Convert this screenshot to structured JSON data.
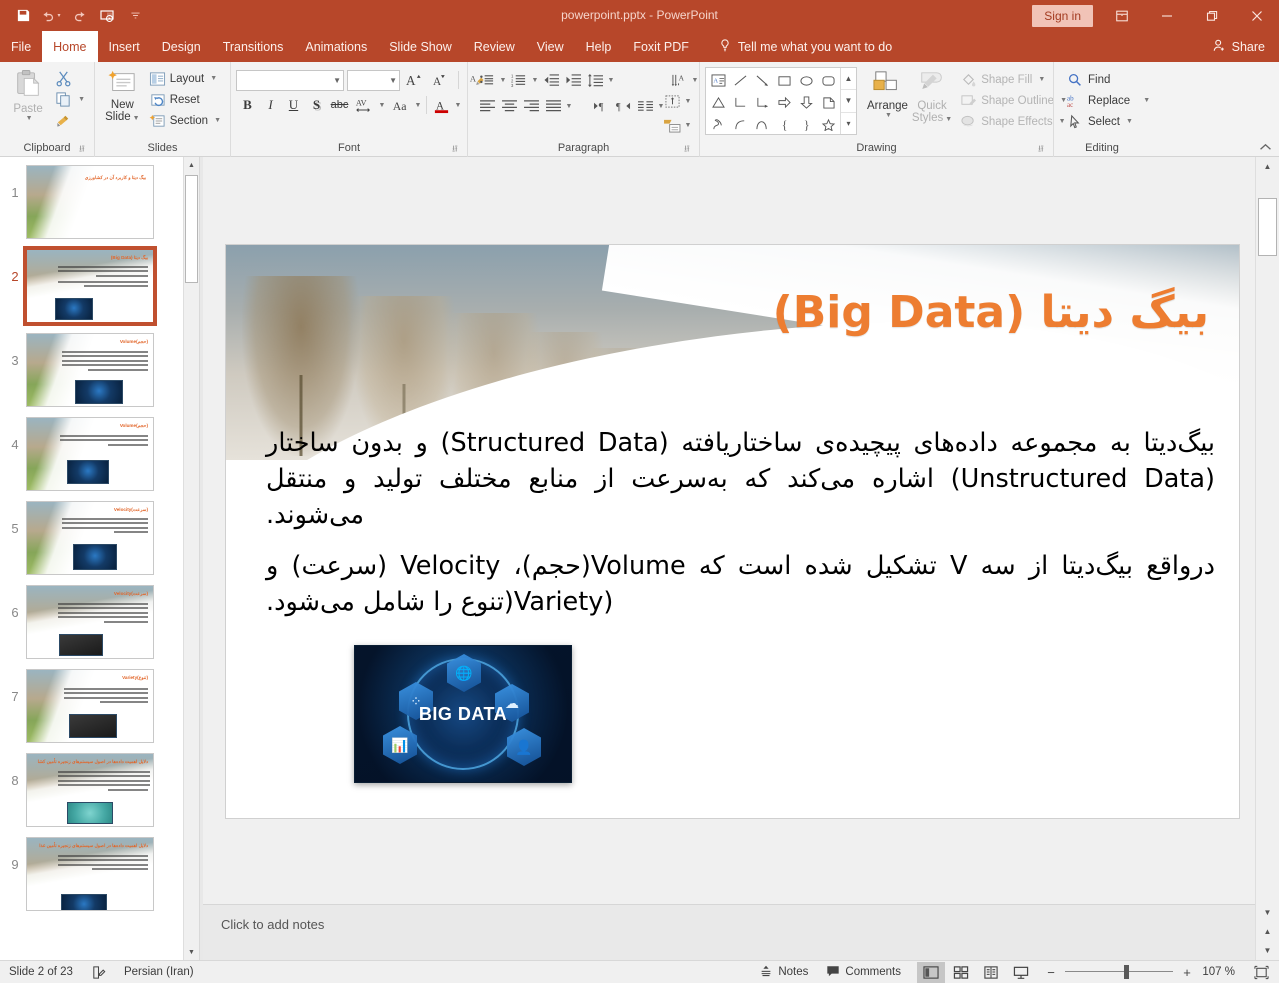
{
  "titlebar": {
    "filename": "powerpoint.pptx  -  PowerPoint",
    "signin_label": "Sign in",
    "qat": [
      {
        "name": "save-icon",
        "label": "Save"
      },
      {
        "name": "undo-icon",
        "label": "Undo"
      },
      {
        "name": "redo-icon",
        "label": "Redo"
      },
      {
        "name": "start-slideshow-icon",
        "label": "Start From Beginning"
      },
      {
        "name": "customize-qat-icon",
        "label": "Customize Quick Access Toolbar"
      }
    ],
    "window_buttons": [
      {
        "name": "ribbon-display-options",
        "glyph": "⬚"
      },
      {
        "name": "minimize-button",
        "glyph": "─"
      },
      {
        "name": "restore-button",
        "glyph": "❐"
      },
      {
        "name": "close-button",
        "glyph": "✕"
      }
    ]
  },
  "tabs": [
    {
      "label": "File",
      "active": false
    },
    {
      "label": "Home",
      "active": true
    },
    {
      "label": "Insert",
      "active": false
    },
    {
      "label": "Design",
      "active": false
    },
    {
      "label": "Transitions",
      "active": false
    },
    {
      "label": "Animations",
      "active": false
    },
    {
      "label": "Slide Show",
      "active": false
    },
    {
      "label": "Review",
      "active": false
    },
    {
      "label": "View",
      "active": false
    },
    {
      "label": "Help",
      "active": false
    },
    {
      "label": "Foxit PDF",
      "active": false
    }
  ],
  "tellme": {
    "label": "Tell me what you want to do",
    "icon": "lightbulb-icon"
  },
  "share": {
    "label": "Share",
    "icon": "share-person-icon"
  },
  "ribbon": {
    "clipboard": {
      "group_label": "Clipboard",
      "paste_label": "Paste",
      "cut_label": "Cut",
      "copy_label": "Copy",
      "format_painter_label": "Format Painter"
    },
    "slides": {
      "group_label": "Slides",
      "new_slide_line1": "New",
      "new_slide_line2": "Slide",
      "layout_label": "Layout",
      "reset_label": "Reset",
      "section_label": "Section"
    },
    "font": {
      "group_label": "Font",
      "font_name_value": "",
      "font_name_placeholder": "",
      "font_size_value": "",
      "buttons": [
        "B",
        "I",
        "U",
        "S",
        "abc",
        "AV",
        "Aa",
        "A"
      ]
    },
    "paragraph": {
      "group_label": "Paragraph"
    },
    "drawing": {
      "group_label": "Drawing",
      "arrange_label": "Arrange",
      "quick_styles_line1": "Quick",
      "quick_styles_line2": "Styles",
      "shape_fill_label": "Shape Fill",
      "shape_outline_label": "Shape Outline",
      "shape_effects_label": "Shape Effects"
    },
    "editing": {
      "group_label": "Editing",
      "find_label": "Find",
      "replace_label": "Replace",
      "select_label": "Select"
    }
  },
  "thumbnails": [
    {
      "num": "1",
      "title": "بیگ دیتا و کاربرد آن در کشاورزی",
      "lines": 0,
      "selected": false,
      "image": "none",
      "layout": "cover"
    },
    {
      "num": "2",
      "title": "بیگ دیتا (Big Data)",
      "lines": 6,
      "selected": true,
      "image": "blue",
      "layout": "content"
    },
    {
      "num": "3",
      "title": "(حجم)Volume",
      "lines": 6,
      "selected": false,
      "image": "blue",
      "layout": "content"
    },
    {
      "num": "4",
      "title": "(حجم)Volume",
      "lines": 3,
      "selected": false,
      "image": "blue",
      "layout": "content"
    },
    {
      "num": "5",
      "title": "(سرعت)Velocity",
      "lines": 4,
      "selected": false,
      "image": "blue",
      "layout": "content"
    },
    {
      "num": "6",
      "title": "(سرعت)Velocity",
      "lines": 5,
      "selected": false,
      "image": "dark",
      "layout": "content"
    },
    {
      "num": "7",
      "title": "(تنوع)Variety",
      "lines": 4,
      "selected": false,
      "image": "dark",
      "layout": "content"
    },
    {
      "num": "8",
      "title": "دلایل اهمیت داده‌ها در اصول سیستم‌های زنجیره تأمین کشا",
      "lines": 6,
      "selected": false,
      "image": "teal",
      "layout": "content"
    },
    {
      "num": "9",
      "title": "دلایل اهمیت داده‌ها در اصول سیستم‌های زنجیره تأمین غذا",
      "lines": 5,
      "selected": false,
      "image": "blue",
      "layout": "content"
    }
  ],
  "slide": {
    "title": "بیگ دیتا (Big Data)",
    "paragraph1": "بیگ‌دیتا به مجموعه داده‌های پیچیده‌ی ساختاریافته (Structured Data) و بدون ساختار (Unstructured Data) اشاره می‌کند که به‌سرعت از منابع مختلف تولید و منتقل می‌شوند.",
    "paragraph2": "درواقع بیگ‌دیتا از سه V تشکیل شده است که Volume(حجم)، Velocity (سرعت) و (Variety(تنوع را شامل می‌شود.",
    "image_caption": "BIG DATA"
  },
  "notes": {
    "placeholder": "Click to add notes"
  },
  "statusbar": {
    "slide_counter": "Slide 2 of 23",
    "language": "Persian (Iran)",
    "notes_label": "Notes",
    "comments_label": "Comments",
    "zoom_percent": "107 %",
    "views": [
      {
        "name": "normal-view-button",
        "active": true
      },
      {
        "name": "slide-sorter-view-button",
        "active": false
      },
      {
        "name": "reading-view-button",
        "active": false
      },
      {
        "name": "slideshow-view-button",
        "active": false
      }
    ]
  },
  "colors": {
    "brand": "#b7472a",
    "accent_orange": "#ed7d31",
    "ribbon_bg": "#f3f3f3",
    "selected_thumb_border": "#c0502f"
  }
}
